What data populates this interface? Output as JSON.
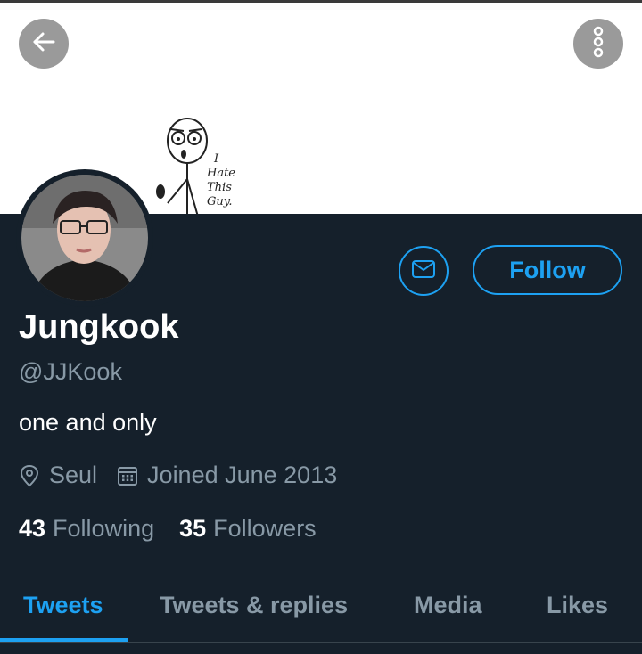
{
  "banner": {
    "sketch_text": [
      "I",
      "Hate",
      "This",
      "Guy."
    ]
  },
  "profile": {
    "name": "Jungkook",
    "handle": "@JJKook",
    "bio": "one and only",
    "location": "Seul",
    "joined": "Joined June 2013",
    "following_count": "43",
    "following_label": "Following",
    "followers_count": "35",
    "followers_label": "Followers"
  },
  "actions": {
    "follow_label": "Follow"
  },
  "tabs": [
    {
      "label": "Tweets",
      "active": true
    },
    {
      "label": "Tweets & replies",
      "active": false
    },
    {
      "label": "Media",
      "active": false
    },
    {
      "label": "Likes",
      "active": false
    }
  ],
  "icons": [
    "back-arrow-icon",
    "more-vertical-icon",
    "mail-icon",
    "location-pin-icon",
    "calendar-icon"
  ],
  "colors": {
    "accent": "#1da1f2",
    "background": "#15202b",
    "muted": "#8899a6"
  }
}
